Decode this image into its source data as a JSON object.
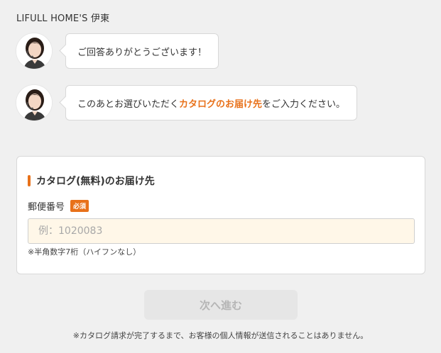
{
  "header": {
    "brand": "LIFULL HOME'S 伊東"
  },
  "chat": {
    "message1": "ご回答ありがとうございます！",
    "message2": {
      "prefix": "このあとお選びいただく",
      "highlight": "カタログのお届け先",
      "suffix": "をご入力ください。"
    }
  },
  "form": {
    "title": "カタログ(無料)のお届け先",
    "postal_label": "郵便番号",
    "required_badge": "必須",
    "postal_placeholder": "例：1020083",
    "postal_value": "",
    "postal_hint": "※半角数字7桁（ハイフンなし）"
  },
  "actions": {
    "next_label": "次へ進む"
  },
  "footer": {
    "privacy_note": "※カタログ請求が完了するまで、お客様の個人情報が送信されることはありません。"
  },
  "colors": {
    "accent": "#e8711a",
    "input_bg": "#fff7e8",
    "page_bg": "#f0f0f0"
  },
  "icons": {
    "avatar": "operator-avatar-icon"
  }
}
